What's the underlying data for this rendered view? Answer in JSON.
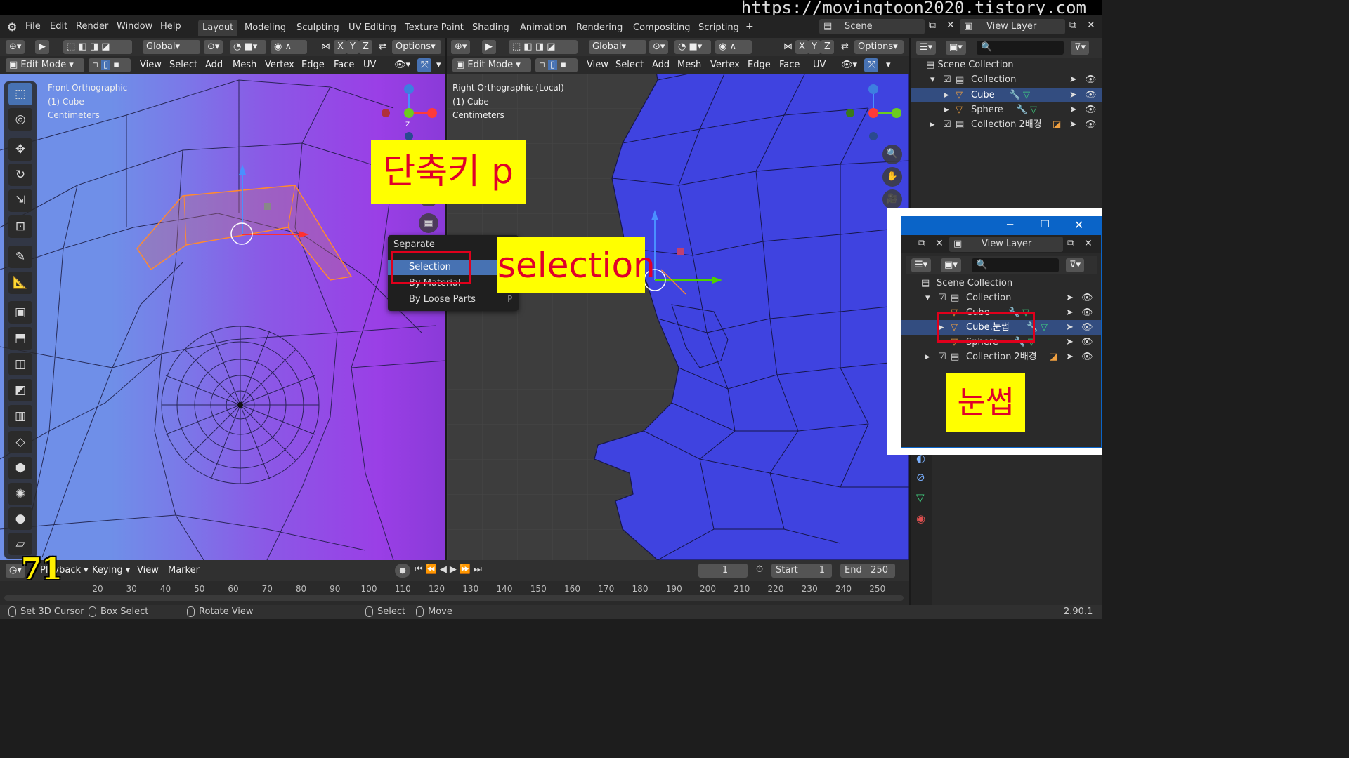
{
  "watermark": "https://movingtoon2020.tistory.com",
  "menu": {
    "items": [
      "File",
      "Edit",
      "Render",
      "Window",
      "Help"
    ]
  },
  "workspaces": [
    "Layout",
    "Modeling",
    "Sculpting",
    "UV Editing",
    "Texture Paint",
    "Shading",
    "Animation",
    "Rendering",
    "Compositing",
    "Scripting"
  ],
  "scene": {
    "label": "Scene",
    "view_layer": "View Layer"
  },
  "header": {
    "transform": "Global",
    "options": "Options",
    "axes": [
      "X",
      "Y",
      "Z"
    ],
    "mode": "Edit Mode",
    "menus": [
      "View",
      "Select",
      "Add",
      "Mesh",
      "Vertex",
      "Edge",
      "Face",
      "UV"
    ]
  },
  "left_vp": {
    "line1": "Front Orthographic",
    "line2": "(1) Cube",
    "line3": "Centimeters"
  },
  "right_vp": {
    "line1": "Right Orthographic (Local)",
    "line2": "(1) Cube",
    "line3": "Centimeters"
  },
  "gizmo": {
    "z": "Z",
    "y": "Y",
    "x": "X"
  },
  "context_menu": {
    "title": "Separate",
    "items": [
      "Selection",
      "By Material",
      "By Loose Parts"
    ],
    "shortcut": "P"
  },
  "annotations": {
    "shortcut": "단축키 p",
    "selection": "selection",
    "eyebrow": "눈썹",
    "frame_number": "71"
  },
  "outliner": {
    "scene_collection": "Scene Collection",
    "rows": [
      {
        "name": "Collection",
        "type": "collection"
      },
      {
        "name": "Cube",
        "type": "mesh",
        "selected": true
      },
      {
        "name": "Sphere",
        "type": "mesh"
      },
      {
        "name": "Collection 2배경",
        "type": "collection"
      }
    ]
  },
  "popup_outliner": {
    "view_layer": "View Layer",
    "scene_collection": "Scene Collection",
    "rows": [
      {
        "name": "Collection"
      },
      {
        "name": "Cube"
      },
      {
        "name": "Cube.눈썹",
        "selected": true
      },
      {
        "name": "Sphere"
      },
      {
        "name": "Collection 2배경"
      }
    ]
  },
  "timeline": {
    "playback": "Playback",
    "keying": "Keying",
    "view": "View",
    "marker": "Marker",
    "current_frame": "1",
    "start_label": "Start",
    "start": "1",
    "end_label": "End",
    "end": "250",
    "ticks": [
      "20",
      "30",
      "40",
      "50",
      "60",
      "70",
      "80",
      "90",
      "100",
      "110",
      "120",
      "130",
      "140",
      "150",
      "160",
      "170",
      "180",
      "190",
      "200",
      "210",
      "220",
      "230",
      "240",
      "250"
    ]
  },
  "status": {
    "items": [
      "Set 3D Cursor",
      "Box Select",
      "Rotate View",
      "Select",
      "Move"
    ],
    "version": "2.90.1"
  }
}
